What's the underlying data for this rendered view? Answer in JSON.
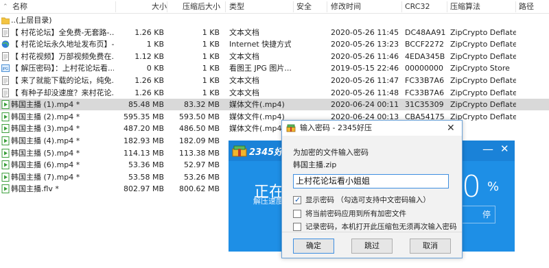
{
  "columns": {
    "name": "名称",
    "size": "大小",
    "compressed": "压缩后大小",
    "type": "类型",
    "security": "安全",
    "modified": "修改时间",
    "crc": "CRC32",
    "method": "压缩算法",
    "path": "路径"
  },
  "rows": [
    {
      "name": "..(上层目录)",
      "size": "",
      "compressed": "",
      "type": "",
      "modified": "",
      "crc": "",
      "method": "",
      "icon": "folder-icon"
    },
    {
      "name": "【 村花论坛】全免费-无套路-...",
      "size": "1.26 KB",
      "compressed": "1 KB",
      "type": "文本文档",
      "modified": "2020-05-26 11:45:...",
      "crc": "DC48AA91",
      "method": "ZipCrypto Deflate",
      "icon": "text-file-icon"
    },
    {
      "name": "【 村花论坛永久地址发布页】-...",
      "size": "1 KB",
      "compressed": "1 KB",
      "type": "Internet 快捷方式",
      "modified": "2020-05-26 13:23:...",
      "crc": "BCCF2272",
      "method": "ZipCrypto Deflate",
      "icon": "internet-shortcut-icon"
    },
    {
      "name": "【 村花视频】万部视频免费在...",
      "size": "1.12 KB",
      "compressed": "1 KB",
      "type": "文本文档",
      "modified": "2020-05-26 11:46:...",
      "crc": "4EDA345B",
      "method": "ZipCrypto Deflate",
      "icon": "text-file-icon"
    },
    {
      "name": "【 解压密码】：上村花论坛看...",
      "size": "0 KB",
      "compressed": "1 KB",
      "type": "看图王 JPG 图片...",
      "modified": "2019-05-15 22:46:...",
      "crc": "00000000",
      "method": "ZipCrypto Store",
      "icon": "jpg-file-icon"
    },
    {
      "name": "【 来了就能下载的论坛，纯免...",
      "size": "1.26 KB",
      "compressed": "1 KB",
      "type": "文本文档",
      "modified": "2020-05-26 11:47:...",
      "crc": "FC33B7A6",
      "method": "ZipCrypto Deflate",
      "icon": "text-file-icon"
    },
    {
      "name": "【 有种子却没速度？来村花论...",
      "size": "1.26 KB",
      "compressed": "1 KB",
      "type": "文本文档",
      "modified": "2020-05-26 11:48:...",
      "crc": "FC33B7A6",
      "method": "ZipCrypto Deflate",
      "icon": "text-file-icon"
    },
    {
      "name": "韩国主播 (1).mp4 *",
      "size": "85.48 MB",
      "compressed": "83.32 MB",
      "type": "媒体文件(.mp4)",
      "modified": "2020-06-24 00:11:...",
      "crc": "31C35309",
      "method": "ZipCrypto Deflate",
      "icon": "media-file-icon",
      "selected": true
    },
    {
      "name": "韩国主播 (2).mp4 *",
      "size": "595.35 MB",
      "compressed": "593.50 MB",
      "type": "媒体文件(.mp4)",
      "modified": "2020-06-24 00:13:...",
      "crc": "CBA54175",
      "method": "ZipCrypto Deflate",
      "icon": "media-file-icon"
    },
    {
      "name": "韩国主播 (3).mp4 *",
      "size": "487.20 MB",
      "compressed": "486.50 MB",
      "type": "媒体文件(.mp4)",
      "modified": "",
      "crc": "",
      "method": "",
      "icon": "media-file-icon"
    },
    {
      "name": "韩国主播 (4).mp4 *",
      "size": "182.93 MB",
      "compressed": "182.09 MB",
      "type": "",
      "modified": "",
      "crc": "",
      "method": "",
      "icon": "media-file-icon"
    },
    {
      "name": "韩国主播 (5).mp4 *",
      "size": "114.13 MB",
      "compressed": "113.38 MB",
      "type": "",
      "modified": "",
      "crc": "",
      "method": "",
      "icon": "media-file-icon"
    },
    {
      "name": "韩国主播 (6).mp4 *",
      "size": "53.36 MB",
      "compressed": "52.97 MB",
      "type": "",
      "modified": "",
      "crc": "",
      "method": "",
      "icon": "media-file-icon"
    },
    {
      "name": "韩国主播 (7).mp4 *",
      "size": "53.58 MB",
      "compressed": "53.26 MB",
      "type": "",
      "modified": "",
      "crc": "",
      "method": "",
      "icon": "media-file-icon"
    },
    {
      "name": "韩国主播.flv *",
      "size": "802.97 MB",
      "compressed": "800.62 MB",
      "type": "",
      "modified": "",
      "crc": "",
      "method": "",
      "icon": "media-file-icon"
    }
  ],
  "background_app": {
    "brand": "2345好压",
    "status": "正在解",
    "speed_label": "解压速度",
    "percent": "0",
    "percent_sign": "%",
    "pause_label": "停"
  },
  "dialog": {
    "title": "输入密码 - 2345好压",
    "prompt": "为加密的文件输入密码",
    "filename": "韩国主播.zip",
    "password": "上村花论坛看小姐姐",
    "options": [
      {
        "label": "显示密码 （勾选可支持中文密码输入）",
        "checked": true
      },
      {
        "label": "将当前密码应用到所有加密文件",
        "checked": false
      },
      {
        "label": "记录密码，本机打开此压缩包无须再次输入密码",
        "checked": false
      }
    ],
    "ok": "确定",
    "skip": "跳过",
    "cancel": "取消"
  },
  "colors": {
    "selection": "#d9d9d9",
    "app_blue": "#1e8fe6",
    "dialog_accent": "#3d8ee0"
  }
}
